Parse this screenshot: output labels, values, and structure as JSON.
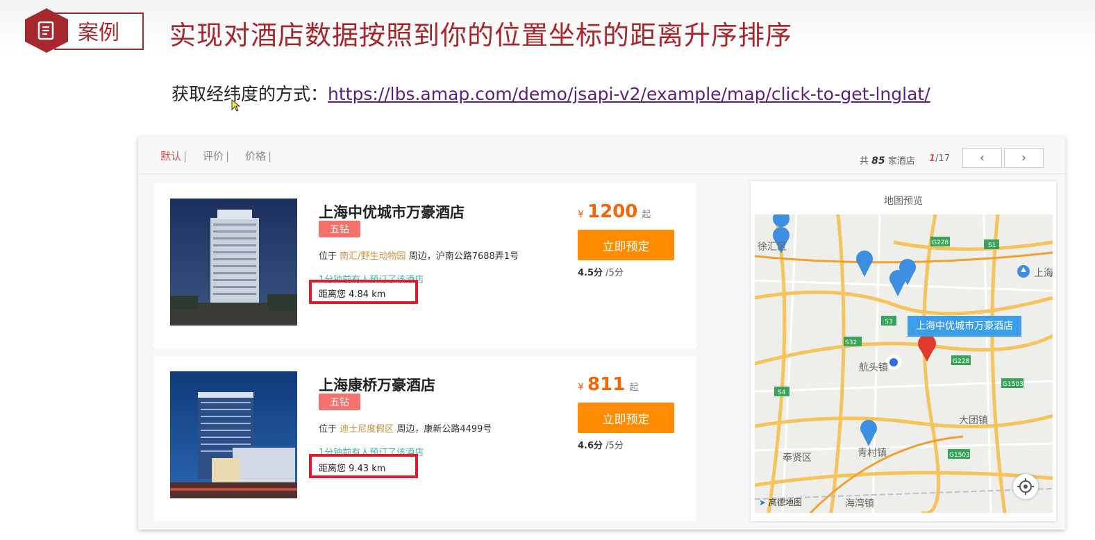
{
  "header": {
    "badge_label": "案例",
    "title": "实现对酒店数据按照到你的位置坐标的距离升序排序",
    "subline_prefix": "获取经纬度的方式：",
    "subline_link": "https://lbs.amap.com/demo/jsapi-v2/example/map/click-to-get-lnglat/"
  },
  "sortbar": {
    "tabs": [
      {
        "label": "默认",
        "sep": "|"
      },
      {
        "label": "评价",
        "sep": "|"
      },
      {
        "label": "价格",
        "sep": "|"
      }
    ],
    "count_prefix": "共",
    "count": "85",
    "count_suffix": "家酒店",
    "page_current": "1",
    "page_total": "/17",
    "prev": "‹",
    "next": "›"
  },
  "hotels": [
    {
      "name": "上海中优城市万豪酒店",
      "level": "五钻",
      "loc_prefix": "位于",
      "area": "南汇/野生动物园",
      "loc_suffix": "周边，沪南公路7688弄1号",
      "booked": "1分钟前有人预订了该酒店",
      "distance": "距离您 4.84 km",
      "currency": "¥",
      "price": "1200",
      "price_suffix": "起",
      "book_label": "立即预定",
      "score": "4.5分",
      "score_max": "/5分"
    },
    {
      "name": "上海康桥万豪酒店",
      "level": "五钻",
      "loc_prefix": "位于",
      "area": "迪士尼度假区",
      "loc_suffix": "周边，康新公路4499号",
      "booked": "1分钟前有人预订了该酒店",
      "distance": "距离您 9.43 km",
      "currency": "¥",
      "price": "811",
      "price_suffix": "起",
      "book_label": "立即预定",
      "score": "4.6分",
      "score_max": "/5分"
    }
  ],
  "map": {
    "title": "地图预览",
    "tooltip": "上海中优城市万豪酒店",
    "labels": [
      "徐汇区",
      "航头镇",
      "大团镇",
      "青村镇",
      "奉贤区",
      "海湾镇",
      "上海"
    ],
    "road_shields": [
      "G228",
      "S1",
      "S3",
      "S32",
      "G228",
      "G1503",
      "S4",
      "G1503"
    ],
    "logo": "高德地图",
    "colors": {
      "land": "#eeeeea",
      "arterial": "#f7c35b",
      "minor": "#ffffff",
      "shield": "#3aa35a",
      "pin": "#3c8ee0",
      "selected_pin": "#e03a2f"
    }
  }
}
